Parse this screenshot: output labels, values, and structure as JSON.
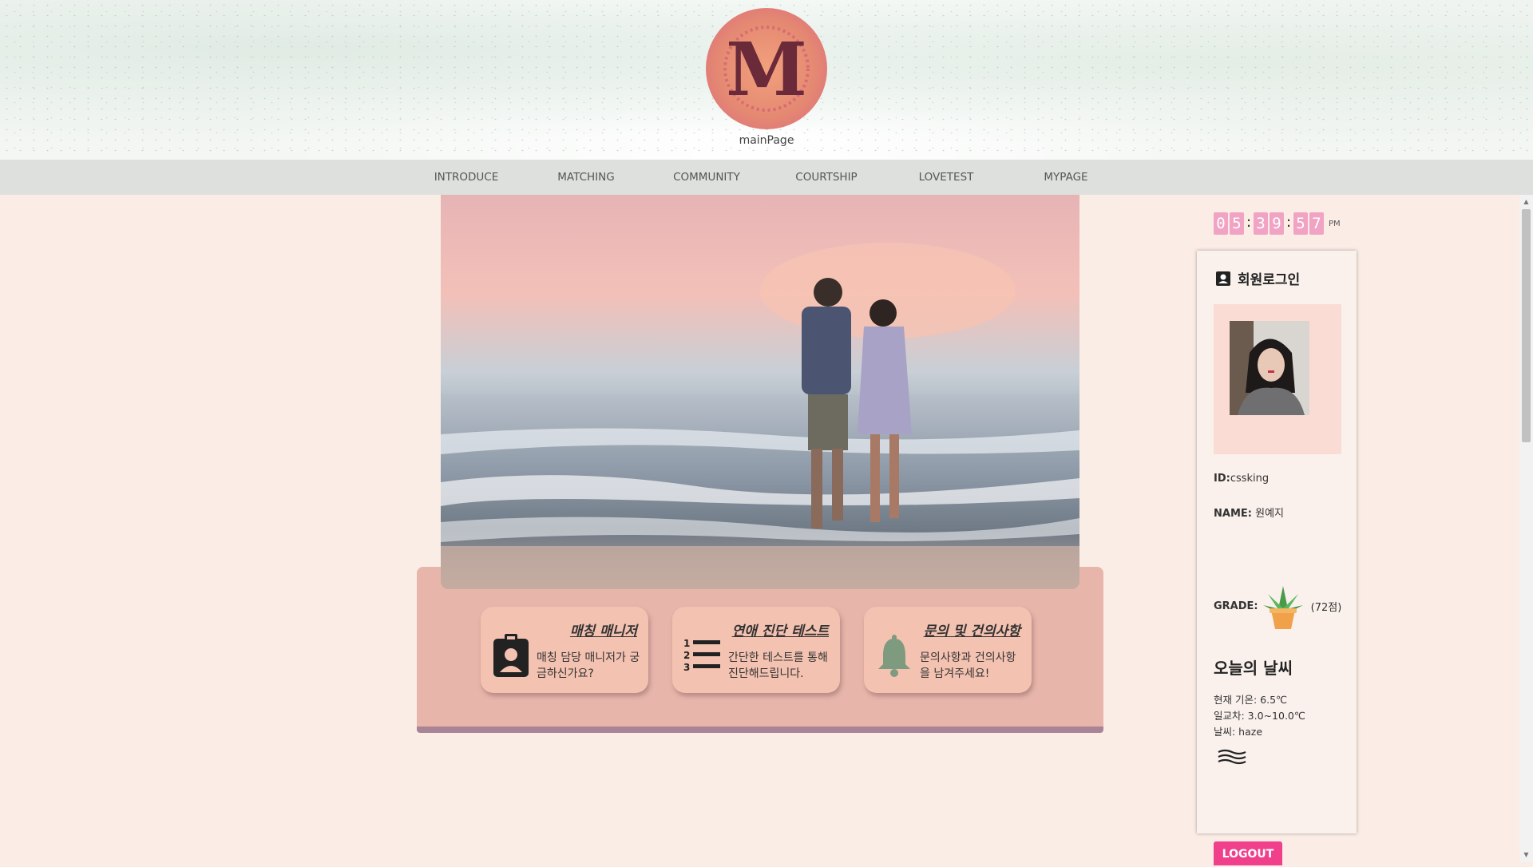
{
  "header": {
    "logo_letter": "M",
    "logo_caption": "mainPage"
  },
  "nav": {
    "items": [
      {
        "label": "INTRODUCE"
      },
      {
        "label": "MATCHING"
      },
      {
        "label": "COMMUNITY"
      },
      {
        "label": "COURTSHIP"
      },
      {
        "label": "LOVETEST"
      },
      {
        "label": "MYPAGE"
      }
    ]
  },
  "hero": {
    "image": "couple-walking-beach-sunset"
  },
  "cards": [
    {
      "title": "매칭 매니저",
      "desc": "매칭 담당 매니저가 궁금하신가요?",
      "icon": "manager-badge-icon"
    },
    {
      "title": "연애 진단 테스트",
      "desc": "간단한 테스트를 통해 진단해드립니다.",
      "icon": "numbered-list-icon"
    },
    {
      "title": "문의 및 건의사항",
      "desc": "문의사항과 건의사항을 남겨주세요!",
      "icon": "bell-icon"
    }
  ],
  "clock": {
    "digits": [
      "0",
      "5",
      "3",
      "9",
      "5",
      "7"
    ],
    "ampm": "PM"
  },
  "login": {
    "title": "회원로그인",
    "id_label": "ID:",
    "id_value": "cssking",
    "name_label": "NAME:",
    "name_value": "원예지",
    "grade_label": "GRADE:",
    "grade_value": "(72점)"
  },
  "weather": {
    "title": "오늘의 날씨",
    "temp": "현재 기온: 6.5℃",
    "range": "일교차: 3.0~10.0℃",
    "condition": "날씨: haze",
    "icon": "haze-icon"
  },
  "logout_label": "LOGOUT",
  "colors": {
    "background": "#fbece6",
    "card_panel": "#e8b5ab",
    "card": "#f4c2b1",
    "clock_digit": "#f1a3c4",
    "logout": "#f0408c"
  }
}
